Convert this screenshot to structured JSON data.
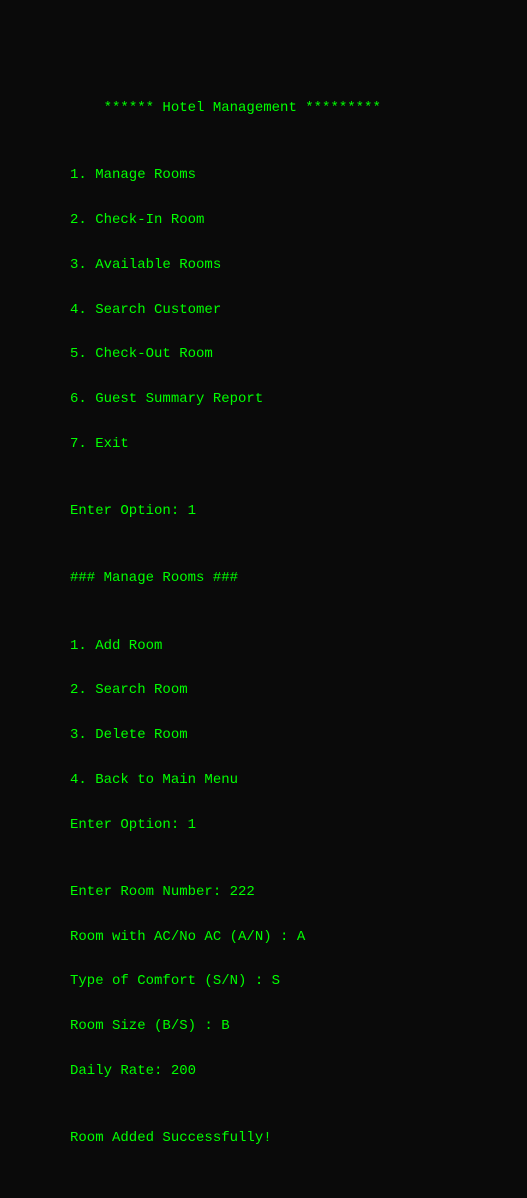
{
  "terminal": {
    "title": "Hotel Management",
    "lines": [
      "****** Hotel Management *********",
      "",
      "1. Manage Rooms",
      "2. Check-In Room",
      "3. Available Rooms",
      "4. Search Customer",
      "5. Check-Out Room",
      "6. Guest Summary Report",
      "7. Exit",
      "",
      "Enter Option: 1",
      "",
      "### Manage Rooms ###",
      "",
      "1. Add Room",
      "2. Search Room",
      "3. Delete Room",
      "4. Back to Main Menu",
      "Enter Option: 1",
      "",
      "Enter Room Number: 222",
      "Room with AC/No AC (A/N) : A",
      "Type of Comfort (S/N) : S",
      "Room Size (B/S) : B",
      "Daily Rate: 200",
      "",
      "Room Added Successfully!"
    ]
  }
}
